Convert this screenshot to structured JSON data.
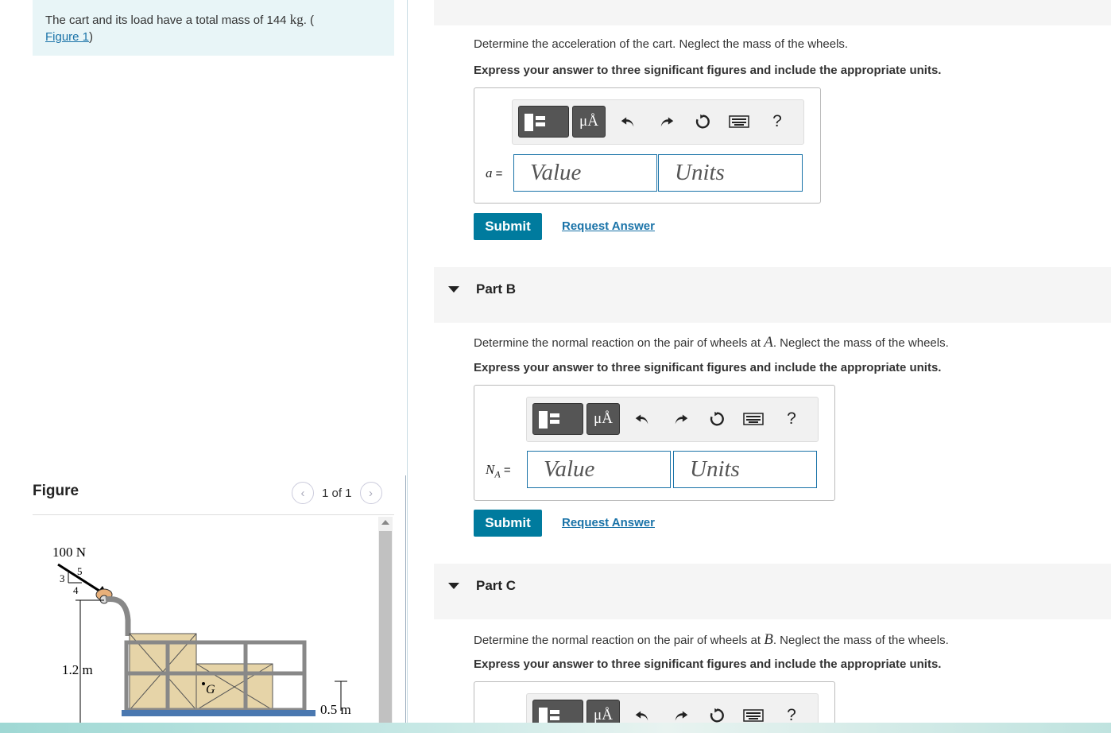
{
  "intro": {
    "text_before": "The cart and its load have a total mass of 144",
    "unit": "kg",
    "text_after": ". (",
    "figure_link": "Figure 1",
    "close_paren": ")"
  },
  "figure_panel": {
    "title": "Figure",
    "pager_text": "1 of 1",
    "prev_icon": "chevron-left-icon",
    "next_icon": "chevron-right-icon",
    "labels": {
      "force": "100 N",
      "slope_3": "3",
      "slope_4": "4",
      "slope_5": "5",
      "height": "1.2 m",
      "center": "G",
      "offset": "0.5 m"
    }
  },
  "part_a": {
    "question": "Determine the acceleration of the cart. Neglect the mass of the wheels.",
    "instruction": "Express your answer to three significant figures and include the appropriate units.",
    "var_name": "a",
    "var_eq": " =",
    "value_placeholder": "Value",
    "units_placeholder": "Units",
    "submit": "Submit",
    "request": "Request Answer"
  },
  "part_b": {
    "label": "Part B",
    "question_before": "Determine the normal reaction on the pair of wheels at ",
    "question_var": "A",
    "question_after": ". Neglect the mass of the wheels.",
    "instruction": "Express your answer to three significant figures and include the appropriate units.",
    "var_name": "N",
    "var_sub": "A",
    "var_eq": " =",
    "value_placeholder": "Value",
    "units_placeholder": "Units",
    "submit": "Submit",
    "request": "Request Answer"
  },
  "part_c": {
    "label": "Part C",
    "question_before": "Determine the normal reaction on the pair of wheels at ",
    "question_var": "B",
    "question_after": ". Neglect the mass of the wheels.",
    "instruction": "Express your answer to three significant figures and include the appropriate units."
  },
  "toolbar": {
    "units_button": "μÅ",
    "help": "?",
    "icons": [
      "templates-icon",
      "units-icon",
      "undo-icon",
      "redo-icon",
      "reset-icon",
      "keyboard-icon",
      "help-icon"
    ]
  },
  "colors": {
    "accent": "#007b9e",
    "link": "#1a73a8",
    "intro_bg": "#e8f5f7",
    "part_header_bg": "#f5f5f5"
  }
}
